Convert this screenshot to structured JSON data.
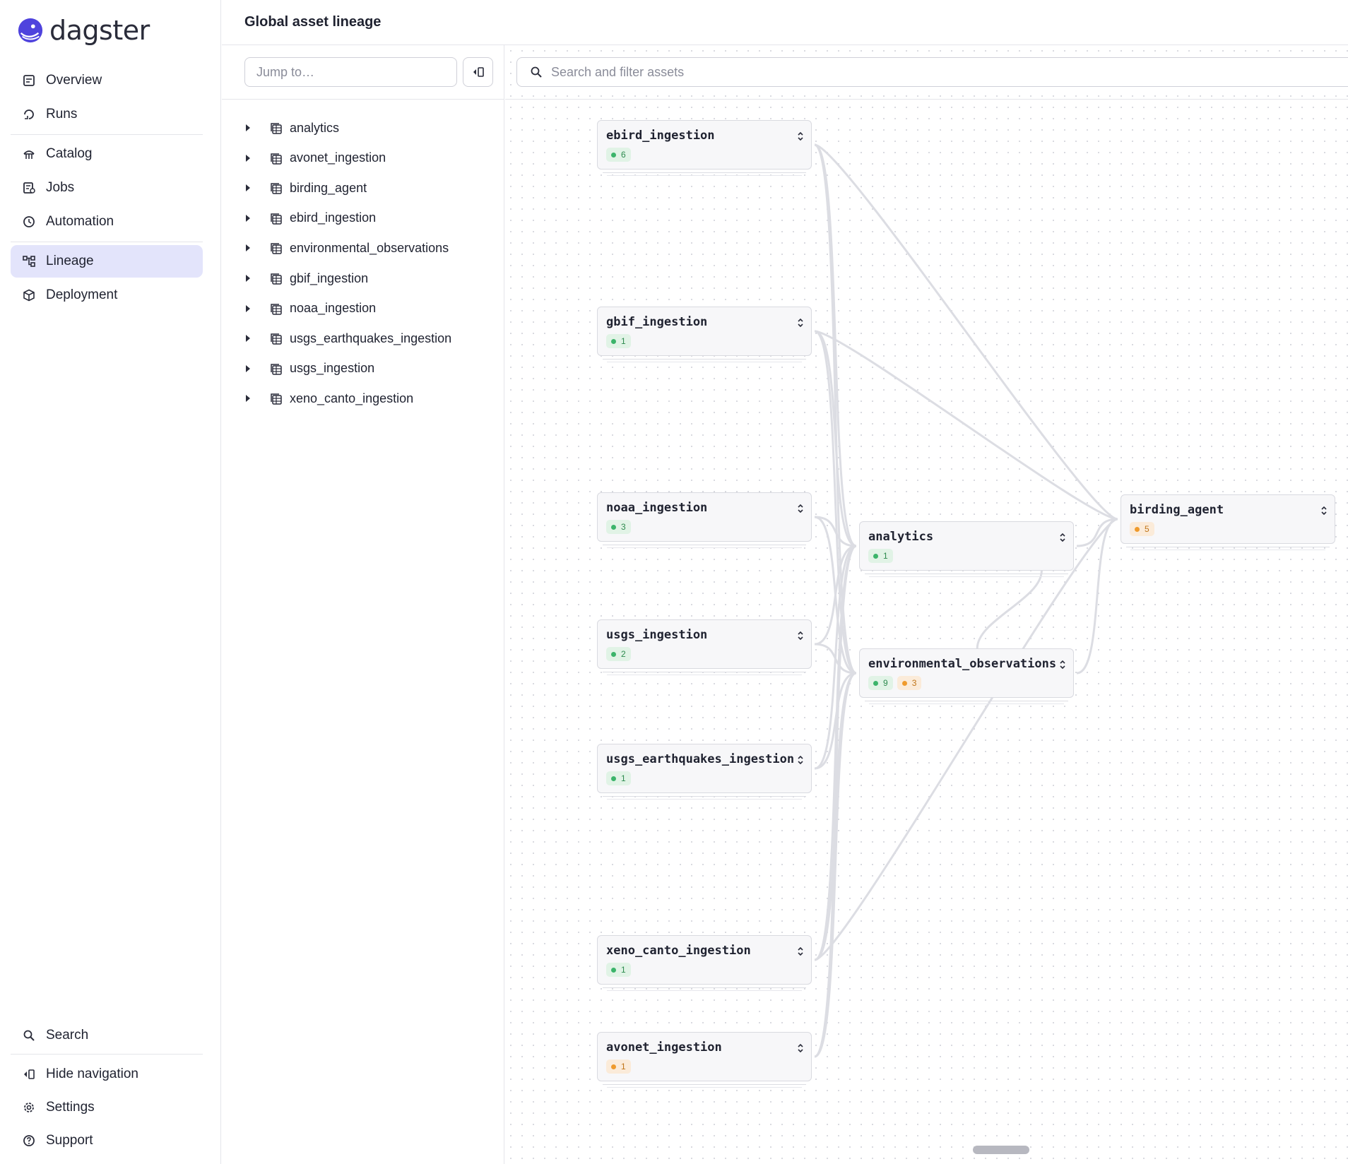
{
  "brand": {
    "name": "dagster",
    "accent": "#4f43dd"
  },
  "nav": {
    "top": [
      {
        "label": "Overview",
        "icon": "overview-icon"
      },
      {
        "label": "Runs",
        "icon": "runs-icon"
      },
      {
        "label": "Catalog",
        "icon": "catalog-icon"
      },
      {
        "label": "Jobs",
        "icon": "jobs-icon"
      },
      {
        "label": "Automation",
        "icon": "clock-icon"
      },
      {
        "label": "Lineage",
        "icon": "lineage-icon",
        "active": true
      },
      {
        "label": "Deployment",
        "icon": "cube-icon"
      }
    ],
    "bottom": [
      {
        "label": "Search",
        "icon": "search-icon"
      },
      {
        "label": "Hide navigation",
        "icon": "panel-toggle-icon"
      },
      {
        "label": "Settings",
        "icon": "gear-icon"
      },
      {
        "label": "Support",
        "icon": "help-icon"
      }
    ]
  },
  "header": {
    "title": "Global asset lineage"
  },
  "asset_panel": {
    "jump_placeholder": "Jump to…",
    "groups": [
      "analytics",
      "avonet_ingestion",
      "birding_agent",
      "ebird_ingestion",
      "environmental_observations",
      "gbif_ingestion",
      "noaa_ingestion",
      "usgs_earthquakes_ingestion",
      "usgs_ingestion",
      "xeno_canto_ingestion"
    ]
  },
  "graph": {
    "search_placeholder": "Search and filter assets",
    "colors": {
      "green": "#3bb46a",
      "orange": "#ef9a2c",
      "edge": "#dcdde3"
    },
    "nodes": [
      {
        "id": "ebird",
        "name": "ebird_ingestion",
        "badges": [
          {
            "color": "green",
            "count": "6"
          }
        ]
      },
      {
        "id": "gbif",
        "name": "gbif_ingestion",
        "badges": [
          {
            "color": "green",
            "count": "1"
          }
        ]
      },
      {
        "id": "noaa",
        "name": "noaa_ingestion",
        "badges": [
          {
            "color": "green",
            "count": "3"
          }
        ]
      },
      {
        "id": "usgs",
        "name": "usgs_ingestion",
        "badges": [
          {
            "color": "green",
            "count": "2"
          }
        ]
      },
      {
        "id": "usgs_eq",
        "name": "usgs_earthquakes_ingestion",
        "badges": [
          {
            "color": "green",
            "count": "1"
          }
        ]
      },
      {
        "id": "xeno",
        "name": "xeno_canto_ingestion",
        "badges": [
          {
            "color": "green",
            "count": "1"
          }
        ]
      },
      {
        "id": "avonet",
        "name": "avonet_ingestion",
        "badges": [
          {
            "color": "orange",
            "count": "1"
          }
        ]
      },
      {
        "id": "analytics",
        "name": "analytics",
        "badges": [
          {
            "color": "green",
            "count": "1"
          }
        ]
      },
      {
        "id": "env",
        "name": "environmental_observations",
        "badges": [
          {
            "color": "green",
            "count": "9"
          },
          {
            "color": "orange",
            "count": "3"
          }
        ]
      },
      {
        "id": "birding",
        "name": "birding_agent",
        "badges": [
          {
            "color": "orange",
            "count": "5"
          }
        ]
      }
    ],
    "edges": [
      [
        "ebird",
        "analytics"
      ],
      [
        "ebird",
        "env"
      ],
      [
        "ebird",
        "birding"
      ],
      [
        "gbif",
        "analytics"
      ],
      [
        "gbif",
        "env"
      ],
      [
        "gbif",
        "birding"
      ],
      [
        "noaa",
        "analytics"
      ],
      [
        "noaa",
        "env"
      ],
      [
        "usgs",
        "analytics"
      ],
      [
        "usgs",
        "env"
      ],
      [
        "usgs_eq",
        "analytics"
      ],
      [
        "usgs_eq",
        "env"
      ],
      [
        "xeno",
        "analytics"
      ],
      [
        "xeno",
        "env"
      ],
      [
        "xeno",
        "birding"
      ],
      [
        "avonet",
        "analytics"
      ],
      [
        "avonet",
        "env"
      ],
      [
        "analytics",
        "birding"
      ],
      [
        "env",
        "birding"
      ],
      [
        "env",
        "analytics"
      ]
    ]
  }
}
